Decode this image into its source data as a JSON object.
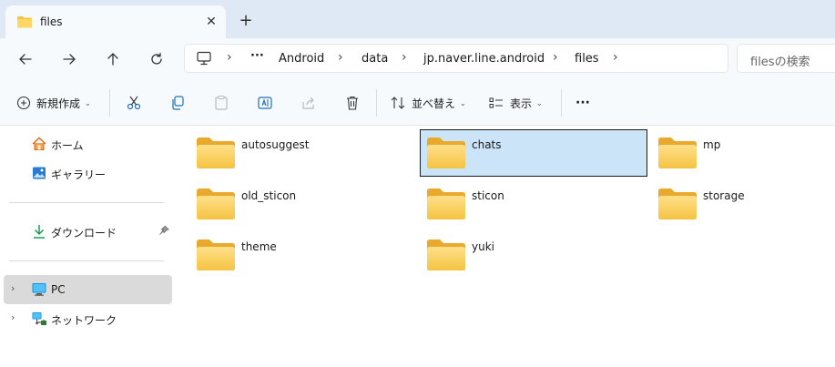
{
  "window": {
    "tab_title": "files",
    "close_tab": "✕",
    "new_tab": "+"
  },
  "nav": {
    "back": "←",
    "forward": "→",
    "up": "↑",
    "refresh": "↻"
  },
  "breadcrumb": {
    "overflow": "···",
    "items": [
      "Android",
      "data",
      "jp.naver.line.android",
      "files"
    ],
    "separator": "›"
  },
  "search": {
    "placeholder": "filesの検索"
  },
  "toolbar": {
    "new_label": "新規作成",
    "sort_label": "並べ替え",
    "view_label": "表示",
    "more": "···"
  },
  "sidebar": {
    "items": [
      {
        "label": "ホーム",
        "icon": "home-icon"
      },
      {
        "label": "ギャラリー",
        "icon": "gallery-icon"
      },
      {
        "label": "ダウンロード",
        "icon": "download-icon"
      },
      {
        "label": "PC",
        "icon": "pc-icon"
      },
      {
        "label": "ネットワーク",
        "icon": "network-icon"
      }
    ]
  },
  "folders": [
    {
      "name": "autosuggest"
    },
    {
      "name": "chats"
    },
    {
      "name": "mp"
    },
    {
      "name": "old_sticon"
    },
    {
      "name": "sticon"
    },
    {
      "name": "storage"
    },
    {
      "name": "theme"
    },
    {
      "name": "yuki"
    }
  ],
  "colors": {
    "accent": "#0067c0",
    "folder": "#f8c84a",
    "selection": "#cce4f7",
    "titlebar": "#dfe9f5"
  }
}
